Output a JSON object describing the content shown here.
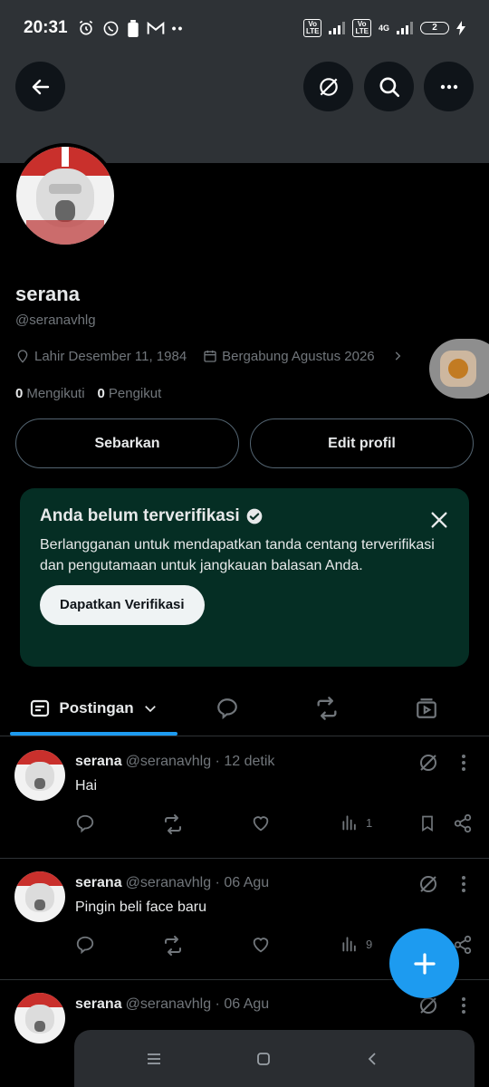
{
  "status_bar": {
    "time": "20:31",
    "network_label": "4G",
    "volte_label": "Vo\nLTE",
    "battery_level": "2"
  },
  "header": {
    "back_icon": "arrow-left-icon",
    "grok_icon": "grok-icon",
    "search_icon": "search-icon",
    "more_icon": "more-horizontal-icon"
  },
  "profile": {
    "name": "serana",
    "handle": "@seranavhlg",
    "birth": "Lahir Desember 11, 1984",
    "joined": "Bergabung Agustus 2026",
    "following_count": "0",
    "following_label": "Mengikuti",
    "followers_count": "0",
    "followers_label": "Pengikut",
    "share_button": "Sebarkan",
    "edit_button": "Edit profil"
  },
  "verification_card": {
    "title": "Anda belum terverifikasi",
    "description": "Berlangganan untuk mendapatkan tanda centang terverifikasi dan pengutamaan untuk jangkauan balasan Anda.",
    "button": "Dapatkan Verifikasi"
  },
  "tabs": [
    {
      "label": "Postingan",
      "icon": "posts-icon",
      "active": true
    },
    {
      "label": "",
      "icon": "reply-icon"
    },
    {
      "label": "",
      "icon": "repost-icon"
    },
    {
      "label": "",
      "icon": "media-icon"
    }
  ],
  "posts": [
    {
      "name": "serana",
      "meta": "@seranavhlg · 12 detik",
      "text": "Hai",
      "views": "1"
    },
    {
      "name": "serana",
      "meta": "@seranavhlg · 06 Agu",
      "text": "Pingin beli face baru",
      "views": "9"
    },
    {
      "name": "serana",
      "meta": "@seranavhlg · 06 Agu",
      "text": "",
      "views": ""
    }
  ],
  "colors": {
    "accent": "#1d9bf0",
    "verify_bg": "#052e24",
    "banner": "#2e3236",
    "muted": "#71767b"
  }
}
